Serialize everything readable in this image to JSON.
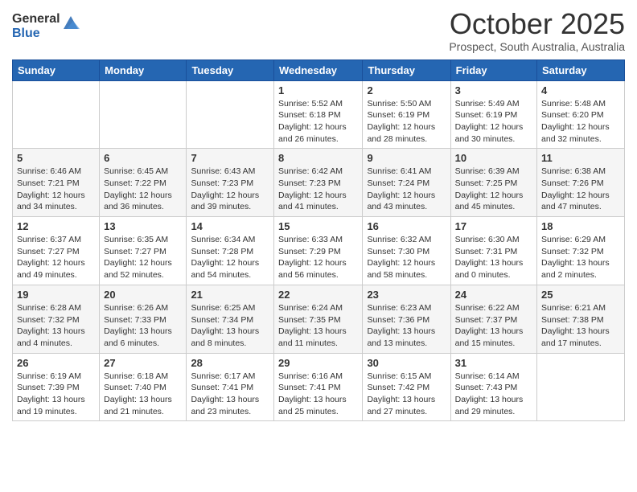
{
  "header": {
    "logo_general": "General",
    "logo_blue": "Blue",
    "month_title": "October 2025",
    "subtitle": "Prospect, South Australia, Australia"
  },
  "days_of_week": [
    "Sunday",
    "Monday",
    "Tuesday",
    "Wednesday",
    "Thursday",
    "Friday",
    "Saturday"
  ],
  "weeks": [
    [
      {
        "day": "",
        "info": ""
      },
      {
        "day": "",
        "info": ""
      },
      {
        "day": "",
        "info": ""
      },
      {
        "day": "1",
        "info": "Sunrise: 5:52 AM\nSunset: 6:18 PM\nDaylight: 12 hours\nand 26 minutes."
      },
      {
        "day": "2",
        "info": "Sunrise: 5:50 AM\nSunset: 6:19 PM\nDaylight: 12 hours\nand 28 minutes."
      },
      {
        "day": "3",
        "info": "Sunrise: 5:49 AM\nSunset: 6:19 PM\nDaylight: 12 hours\nand 30 minutes."
      },
      {
        "day": "4",
        "info": "Sunrise: 5:48 AM\nSunset: 6:20 PM\nDaylight: 12 hours\nand 32 minutes."
      }
    ],
    [
      {
        "day": "5",
        "info": "Sunrise: 6:46 AM\nSunset: 7:21 PM\nDaylight: 12 hours\nand 34 minutes."
      },
      {
        "day": "6",
        "info": "Sunrise: 6:45 AM\nSunset: 7:22 PM\nDaylight: 12 hours\nand 36 minutes."
      },
      {
        "day": "7",
        "info": "Sunrise: 6:43 AM\nSunset: 7:23 PM\nDaylight: 12 hours\nand 39 minutes."
      },
      {
        "day": "8",
        "info": "Sunrise: 6:42 AM\nSunset: 7:23 PM\nDaylight: 12 hours\nand 41 minutes."
      },
      {
        "day": "9",
        "info": "Sunrise: 6:41 AM\nSunset: 7:24 PM\nDaylight: 12 hours\nand 43 minutes."
      },
      {
        "day": "10",
        "info": "Sunrise: 6:39 AM\nSunset: 7:25 PM\nDaylight: 12 hours\nand 45 minutes."
      },
      {
        "day": "11",
        "info": "Sunrise: 6:38 AM\nSunset: 7:26 PM\nDaylight: 12 hours\nand 47 minutes."
      }
    ],
    [
      {
        "day": "12",
        "info": "Sunrise: 6:37 AM\nSunset: 7:27 PM\nDaylight: 12 hours\nand 49 minutes."
      },
      {
        "day": "13",
        "info": "Sunrise: 6:35 AM\nSunset: 7:27 PM\nDaylight: 12 hours\nand 52 minutes."
      },
      {
        "day": "14",
        "info": "Sunrise: 6:34 AM\nSunset: 7:28 PM\nDaylight: 12 hours\nand 54 minutes."
      },
      {
        "day": "15",
        "info": "Sunrise: 6:33 AM\nSunset: 7:29 PM\nDaylight: 12 hours\nand 56 minutes."
      },
      {
        "day": "16",
        "info": "Sunrise: 6:32 AM\nSunset: 7:30 PM\nDaylight: 12 hours\nand 58 minutes."
      },
      {
        "day": "17",
        "info": "Sunrise: 6:30 AM\nSunset: 7:31 PM\nDaylight: 13 hours\nand 0 minutes."
      },
      {
        "day": "18",
        "info": "Sunrise: 6:29 AM\nSunset: 7:32 PM\nDaylight: 13 hours\nand 2 minutes."
      }
    ],
    [
      {
        "day": "19",
        "info": "Sunrise: 6:28 AM\nSunset: 7:32 PM\nDaylight: 13 hours\nand 4 minutes."
      },
      {
        "day": "20",
        "info": "Sunrise: 6:26 AM\nSunset: 7:33 PM\nDaylight: 13 hours\nand 6 minutes."
      },
      {
        "day": "21",
        "info": "Sunrise: 6:25 AM\nSunset: 7:34 PM\nDaylight: 13 hours\nand 8 minutes."
      },
      {
        "day": "22",
        "info": "Sunrise: 6:24 AM\nSunset: 7:35 PM\nDaylight: 13 hours\nand 11 minutes."
      },
      {
        "day": "23",
        "info": "Sunrise: 6:23 AM\nSunset: 7:36 PM\nDaylight: 13 hours\nand 13 minutes."
      },
      {
        "day": "24",
        "info": "Sunrise: 6:22 AM\nSunset: 7:37 PM\nDaylight: 13 hours\nand 15 minutes."
      },
      {
        "day": "25",
        "info": "Sunrise: 6:21 AM\nSunset: 7:38 PM\nDaylight: 13 hours\nand 17 minutes."
      }
    ],
    [
      {
        "day": "26",
        "info": "Sunrise: 6:19 AM\nSunset: 7:39 PM\nDaylight: 13 hours\nand 19 minutes."
      },
      {
        "day": "27",
        "info": "Sunrise: 6:18 AM\nSunset: 7:40 PM\nDaylight: 13 hours\nand 21 minutes."
      },
      {
        "day": "28",
        "info": "Sunrise: 6:17 AM\nSunset: 7:41 PM\nDaylight: 13 hours\nand 23 minutes."
      },
      {
        "day": "29",
        "info": "Sunrise: 6:16 AM\nSunset: 7:41 PM\nDaylight: 13 hours\nand 25 minutes."
      },
      {
        "day": "30",
        "info": "Sunrise: 6:15 AM\nSunset: 7:42 PM\nDaylight: 13 hours\nand 27 minutes."
      },
      {
        "day": "31",
        "info": "Sunrise: 6:14 AM\nSunset: 7:43 PM\nDaylight: 13 hours\nand 29 minutes."
      },
      {
        "day": "",
        "info": ""
      }
    ]
  ]
}
